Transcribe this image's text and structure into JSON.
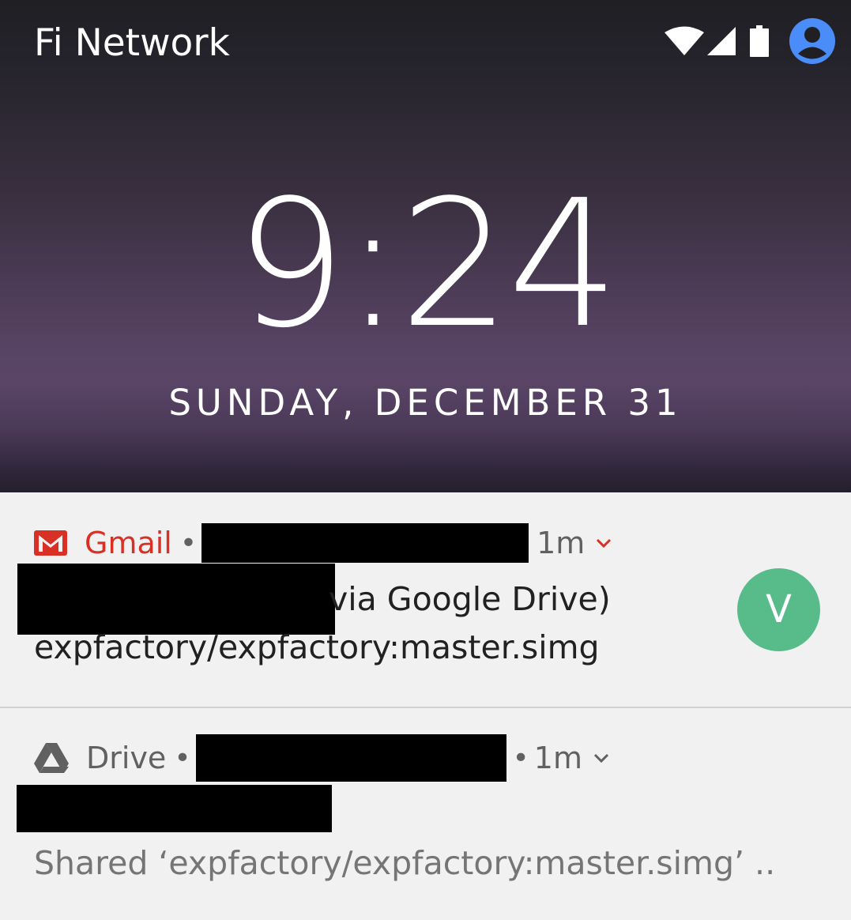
{
  "status_bar": {
    "carrier": "Fi Network",
    "icons": [
      "wifi-icon",
      "signal-icon",
      "battery-icon",
      "account-icon"
    ]
  },
  "lockscreen": {
    "time": "9:24",
    "date": "SUNDAY, DECEMBER 31"
  },
  "notifications": [
    {
      "app": "Gmail",
      "app_icon": "gmail-icon",
      "separator": "•",
      "time": "1m",
      "title_visible": "via Google Drive)",
      "body": "expfactory/expfactory:master.simg",
      "avatar_letter": "V",
      "accent_color": "#d93025",
      "avatar_color": "#57bb8a"
    },
    {
      "app": "Drive",
      "app_icon": "drive-icon",
      "separator": "•",
      "time_prefix": "•",
      "time": "1m",
      "body": "Shared ‘expfactory/expfactory:master.simg’ .."
    }
  ]
}
